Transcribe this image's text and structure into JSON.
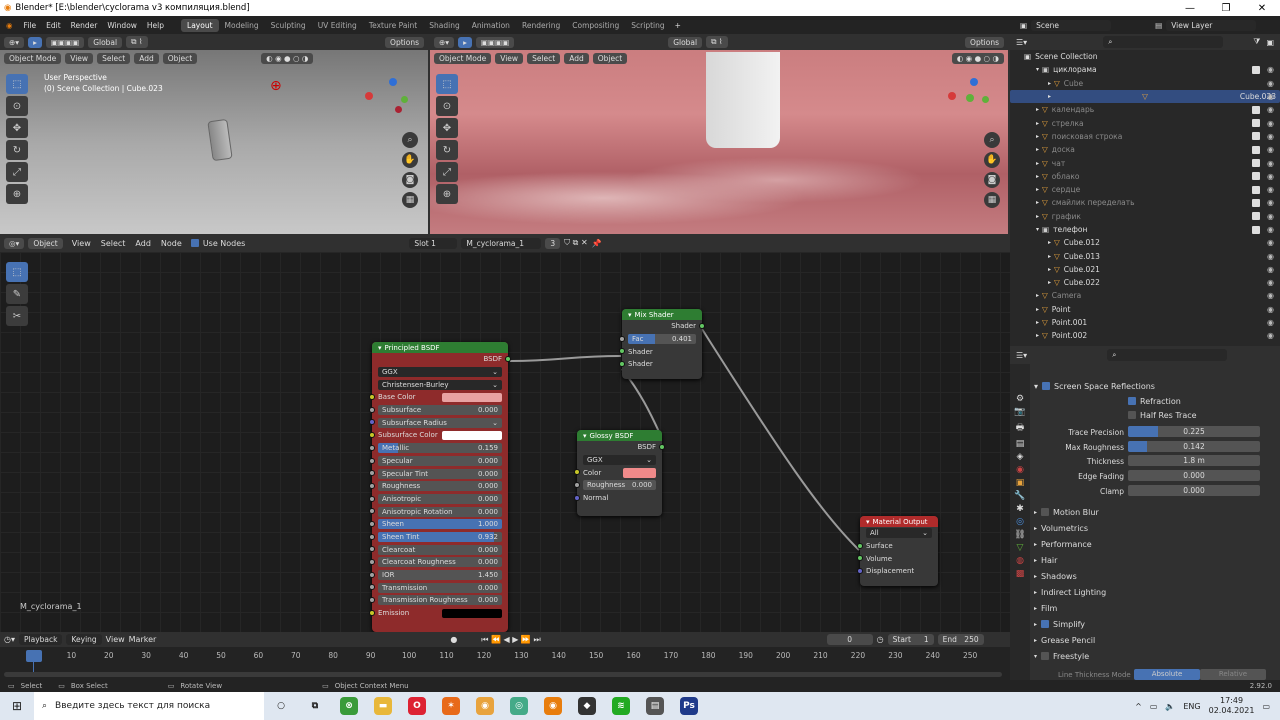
{
  "window": {
    "title": "Blender* [E:\\blender\\cyclorama v3 компиляция.blend]"
  },
  "topmenu": {
    "items": [
      "File",
      "Edit",
      "Render",
      "Window",
      "Help"
    ],
    "workspaces": [
      "Layout",
      "Modeling",
      "Sculpting",
      "UV Editing",
      "Texture Paint",
      "Shading",
      "Animation",
      "Rendering",
      "Compositing",
      "Scripting"
    ],
    "scene": "Scene",
    "view_layer": "View Layer"
  },
  "viewport_left": {
    "mode": "Object Mode",
    "menus": [
      "View",
      "Select",
      "Add",
      "Object"
    ],
    "transform": "Global",
    "options": "Options",
    "perspective": "User Perspective",
    "collection": "(0) Scene Collection | Cube.023"
  },
  "viewport_right": {
    "mode": "Object Mode",
    "menus": [
      "View",
      "Select",
      "Add",
      "Object"
    ],
    "transform": "Global",
    "options": "Options"
  },
  "node_header": {
    "type": "Object",
    "menus": [
      "View",
      "Select",
      "Add",
      "Node"
    ],
    "use_nodes": "Use Nodes",
    "slot": "Slot 1",
    "material": "M_cyclorama_1",
    "users": "3"
  },
  "node_editor": {
    "material_label": "M_cyclorama_1"
  },
  "principled": {
    "title": "Principled BSDF",
    "output": "BSDF",
    "dist": "GGX",
    "sss_method": "Christensen-Burley",
    "fields": [
      {
        "label": "Base Color",
        "kind": "color",
        "color": "#e8a3a3",
        "sock": "y"
      },
      {
        "label": "Subsurface",
        "value": "0.000",
        "sock": "gr"
      },
      {
        "label": "Subsurface Radius",
        "kind": "select",
        "sock": "b"
      },
      {
        "label": "Subsurface Color",
        "kind": "color",
        "color": "#ffffff",
        "sock": "y"
      },
      {
        "label": "Metallic",
        "value": "0.159",
        "fill": 0.159,
        "sock": "gr"
      },
      {
        "label": "Specular",
        "value": "0.000",
        "sock": "gr"
      },
      {
        "label": "Specular Tint",
        "value": "0.000",
        "sock": "gr"
      },
      {
        "label": "Roughness",
        "value": "0.000",
        "sock": "gr"
      },
      {
        "label": "Anisotropic",
        "value": "0.000",
        "sock": "gr"
      },
      {
        "label": "Anisotropic Rotation",
        "value": "0.000",
        "sock": "gr"
      },
      {
        "label": "Sheen",
        "value": "1.000",
        "fill": 1.0,
        "sock": "gr"
      },
      {
        "label": "Sheen Tint",
        "value": "0.932",
        "fill": 0.932,
        "sock": "gr"
      },
      {
        "label": "Clearcoat",
        "value": "0.000",
        "sock": "gr"
      },
      {
        "label": "Clearcoat Roughness",
        "value": "0.000",
        "sock": "gr"
      },
      {
        "label": "IOR",
        "value": "1.450",
        "sock": "gr",
        "center": true
      },
      {
        "label": "Transmission",
        "value": "0.000",
        "sock": "gr"
      },
      {
        "label": "Transmission Roughness",
        "value": "0.000",
        "sock": "gr"
      },
      {
        "label": "Emission",
        "kind": "color",
        "color": "#000000",
        "sock": "y"
      }
    ]
  },
  "mix": {
    "title": "Mix Shader",
    "output": "Shader",
    "fac_label": "Fac",
    "fac": "0.401",
    "fac_fill": 0.401,
    "in1": "Shader",
    "in2": "Shader"
  },
  "glossy": {
    "title": "Glossy BSDF",
    "output": "BSDF",
    "dist": "GGX",
    "color_label": "Color",
    "color": "#f08a8a",
    "rough_label": "Roughness",
    "rough": "0.000",
    "normal": "Normal"
  },
  "output": {
    "title": "Material Output",
    "target": "All",
    "surface": "Surface",
    "volume": "Volume",
    "displacement": "Displacement"
  },
  "outliner": {
    "root": "Scene Collection",
    "items": [
      {
        "name": "циклорама",
        "depth": 1,
        "kind": "col",
        "chk": true
      },
      {
        "name": "Cube",
        "depth": 2,
        "kind": "obj",
        "dim": true
      },
      {
        "name": "Cube.023",
        "depth": 2,
        "kind": "obj",
        "selected": true
      },
      {
        "name": "календарь",
        "depth": 1,
        "kind": "obj",
        "dim": true,
        "chk": true
      },
      {
        "name": "стрелка",
        "depth": 1,
        "kind": "obj",
        "dim": true,
        "chk": true
      },
      {
        "name": "поисковая строка",
        "depth": 1,
        "kind": "obj",
        "dim": true,
        "chk": true
      },
      {
        "name": "доска",
        "depth": 1,
        "kind": "obj",
        "dim": true,
        "chk": true
      },
      {
        "name": "чат",
        "depth": 1,
        "kind": "obj",
        "dim": true,
        "chk": true
      },
      {
        "name": "облако",
        "depth": 1,
        "kind": "obj",
        "dim": true,
        "chk": true
      },
      {
        "name": "сердце",
        "depth": 1,
        "kind": "obj",
        "dim": true,
        "chk": true
      },
      {
        "name": "смайлик переделать",
        "depth": 1,
        "kind": "obj",
        "dim": true,
        "chk": true
      },
      {
        "name": "график",
        "depth": 1,
        "kind": "obj",
        "dim": true,
        "chk": true
      },
      {
        "name": "телефон",
        "depth": 1,
        "kind": "col",
        "chk": true
      },
      {
        "name": "Cube.012",
        "depth": 2,
        "kind": "obj"
      },
      {
        "name": "Cube.013",
        "depth": 2,
        "kind": "obj"
      },
      {
        "name": "Cube.021",
        "depth": 2,
        "kind": "obj"
      },
      {
        "name": "Cube.022",
        "depth": 2,
        "kind": "obj"
      },
      {
        "name": "Camera",
        "depth": 1,
        "kind": "obj",
        "dim": true
      },
      {
        "name": "Point",
        "depth": 1,
        "kind": "obj"
      },
      {
        "name": "Point.001",
        "depth": 1,
        "kind": "obj"
      },
      {
        "name": "Point.002",
        "depth": 1,
        "kind": "obj"
      }
    ]
  },
  "props": {
    "ssr": "Screen Space Reflections",
    "refraction": "Refraction",
    "half_res": "Half Res Trace",
    "fields": [
      {
        "label": "Trace Precision",
        "value": "0.225",
        "fill": 0.225
      },
      {
        "label": "Max Roughness",
        "value": "0.142",
        "fill": 0.142
      },
      {
        "label": "Thickness",
        "value": "1.8 m"
      },
      {
        "label": "Edge Fading",
        "value": "0.000"
      },
      {
        "label": "Clamp",
        "value": "0.000"
      }
    ],
    "panels": [
      "Motion Blur",
      "Volumetrics",
      "Performance",
      "Hair",
      "Shadows",
      "Indirect Lighting",
      "Film",
      "Simplify",
      "Grease Pencil",
      "Freestyle"
    ],
    "line_mode_label": "Line Thickness Mode",
    "line_mode_a": "Absolute",
    "line_mode_b": "Relative"
  },
  "timeline": {
    "playback": "Playback",
    "keying": "Keying",
    "view": "View",
    "marker": "Marker",
    "current": "0",
    "start_label": "Start",
    "start": "1",
    "end_label": "End",
    "end": "250",
    "ticks": [
      "0",
      "10",
      "20",
      "30",
      "40",
      "50",
      "60",
      "70",
      "80",
      "90",
      "100",
      "110",
      "120",
      "130",
      "140",
      "150",
      "160",
      "170",
      "180",
      "190",
      "200",
      "210",
      "220",
      "230",
      "240",
      "250"
    ]
  },
  "status": {
    "select": "Select",
    "box_select": "Box Select",
    "rotate": "Rotate View",
    "context": "Object Context Menu",
    "version": "2.92.0"
  },
  "taskbar": {
    "search": "Введите здесь текст для поиска",
    "lang": "ENG",
    "time": "17:49",
    "date": "02.04.2021"
  },
  "colors": {
    "accent": "#4772b3",
    "principled_header": "#8e2b2b",
    "shader_header": "#2e7d32",
    "output_header": "#b02b2b"
  }
}
